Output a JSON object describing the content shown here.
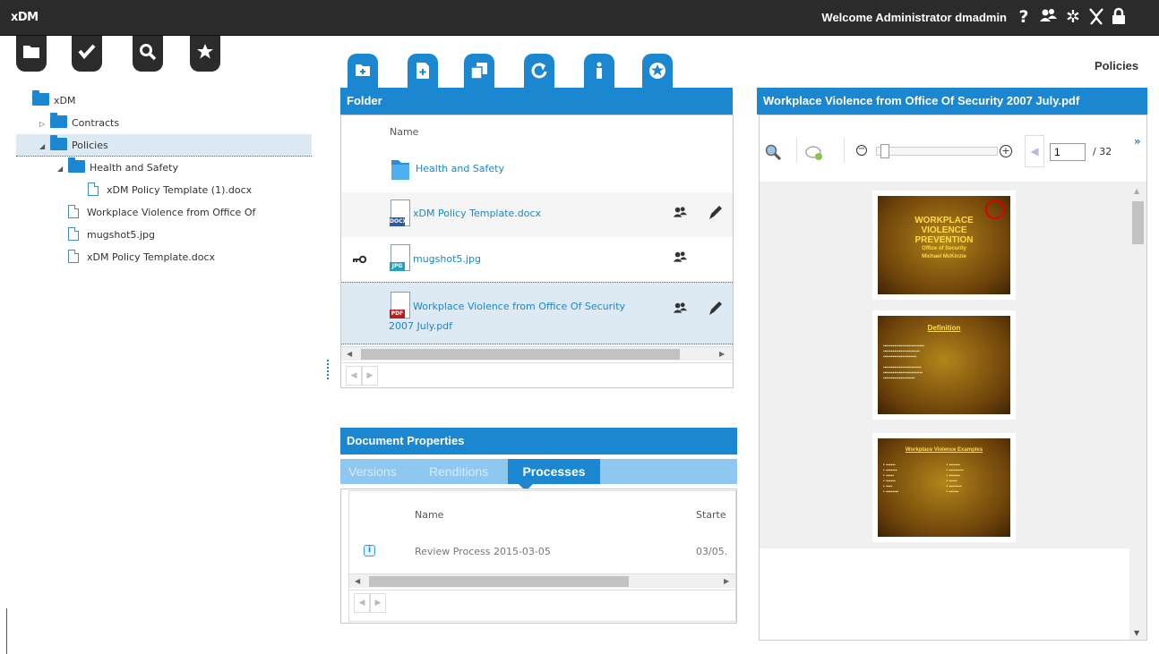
{
  "app": {
    "logo": "xDM",
    "welcome": "Welcome Administrator dmadmin",
    "page_title": "Policies"
  },
  "topbar_icons": [
    "help-icon",
    "users-icon",
    "gear-icon",
    "accessibility-icon",
    "lock-icon"
  ],
  "nav_tabs": [
    "folder-icon",
    "check-icon",
    "search-icon",
    "star-icon"
  ],
  "tree": [
    {
      "label": "xDM",
      "level": 0,
      "type": "folder",
      "expander": ""
    },
    {
      "label": "Contracts",
      "level": 1,
      "type": "folder",
      "expander": "▷"
    },
    {
      "label": "Policies",
      "level": 1,
      "type": "folder",
      "expander": "◢",
      "selected": true
    },
    {
      "label": "Health and Safety",
      "level": 2,
      "type": "folder",
      "expander": "◢"
    },
    {
      "label": "xDM Policy Template (1).docx",
      "level": 3,
      "type": "doc",
      "expander": ""
    },
    {
      "label": "Workplace Violence from Office Of",
      "level": 2,
      "type": "doc",
      "expander": ""
    },
    {
      "label": "mugshot5.jpg",
      "level": 2,
      "type": "doc",
      "expander": ""
    },
    {
      "label": "xDM Policy Template.docx",
      "level": 2,
      "type": "doc",
      "expander": ""
    }
  ],
  "folder_panel": {
    "title": "Folder",
    "column_name": "Name",
    "toolbar": [
      "new-folder-icon",
      "new-document-icon",
      "copy-icon",
      "refresh-icon",
      "info-icon",
      "favorite-icon"
    ],
    "rows": [
      {
        "name": "Health and Safety",
        "kind": "folder"
      },
      {
        "name": "xDM Policy Template.docx",
        "kind": "docx",
        "badge": "DOCX"
      },
      {
        "name": "mugshot5.jpg",
        "kind": "jpg",
        "badge": "JPG"
      },
      {
        "name": "Workplace Violence from Office Of Security 2007 July.pdf",
        "kind": "pdf",
        "badge": "PDF"
      }
    ]
  },
  "doc_props": {
    "title": "Document Properties",
    "tabs": [
      "Versions",
      "Renditions",
      "Processes"
    ],
    "active_tab": "Processes",
    "columns": [
      "Name",
      "Starte"
    ],
    "rows": [
      {
        "name": "Review Process 2015-03-05",
        "started": "03/05."
      }
    ]
  },
  "viewer": {
    "title": "Workplace Violence from Office Of Security 2007 July.pdf",
    "page": "1",
    "total": "/ 32",
    "next": "»",
    "slides": [
      {
        "lines": [
          "WORKPLACE",
          "VIOLENCE",
          "PREVENTION",
          "Office of Security",
          "Michael McKinzie"
        ]
      },
      {
        "lines": [
          "Definition"
        ]
      },
      {
        "lines": [
          "Workplace Violence Examples"
        ]
      }
    ]
  }
}
